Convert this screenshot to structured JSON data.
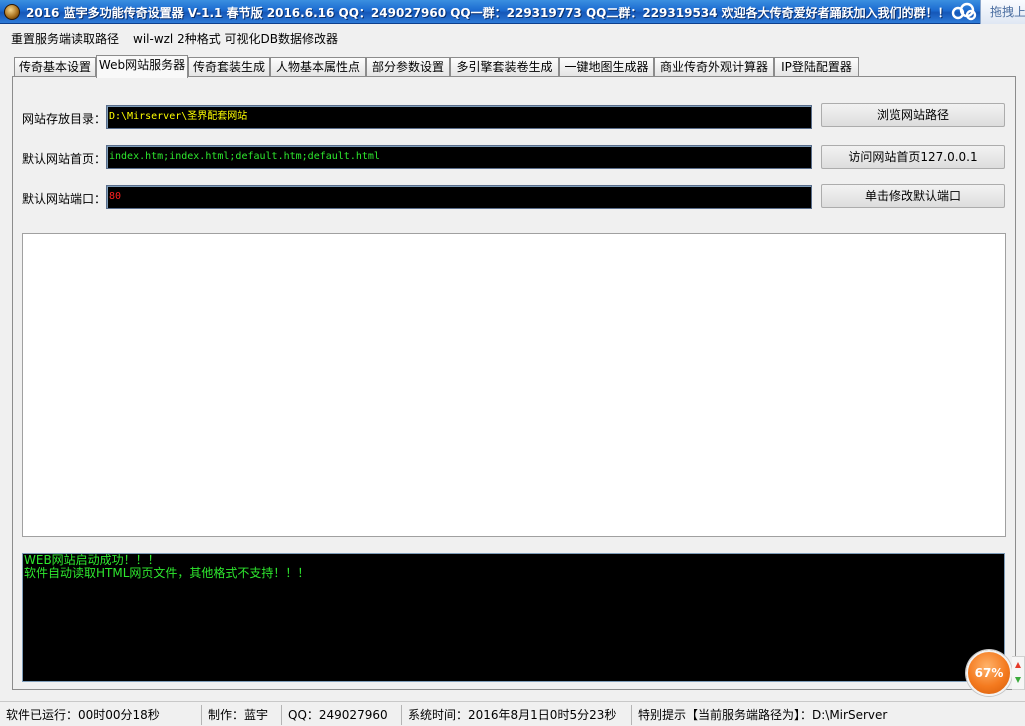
{
  "window": {
    "title": "2016 蓝宇多功能传奇设置器 V-1.1 春节版 2016.6.16  QQ：249027960 QQ一群：229319773 QQ二群：229319534  欢迎各大传奇爱好者踊跃加入我们的群！！",
    "drag_button": "拖拽上"
  },
  "menu": {
    "reset_path": "重置服务端读取路径",
    "db_editor": "wil-wzl 2种格式 可视化DB数据修改器"
  },
  "tabs": [
    {
      "label": "传奇基本设置"
    },
    {
      "label": "Web网站服务器"
    },
    {
      "label": "传奇套装生成"
    },
    {
      "label": "人物基本属性点"
    },
    {
      "label": "部分参数设置"
    },
    {
      "label": "多引擎套装卷生成"
    },
    {
      "label": "一键地图生成器"
    },
    {
      "label": "商业传奇外观计算器"
    },
    {
      "label": "IP登陆配置器"
    }
  ],
  "active_tab": "Web网站服务器",
  "web": {
    "dir_label": "网站存放目录：",
    "dir_value": "D:\\Mirserver\\圣界配套网站",
    "home_label": "默认网站首页：",
    "home_value": "index.htm;index.html;default.htm;default.html",
    "port_label": "默认网站端口：",
    "port_value": "80",
    "browse_button": "浏览网站路径",
    "visit_button": "访问网站首页127.0.0.1",
    "port_button": "单击修改默认端口"
  },
  "log": [
    "WEB网站启动成功！！！",
    "软件自动读取HTML网页文件，其他格式不支持！！！"
  ],
  "status": {
    "runtime": "软件已运行：00时00分18秒",
    "author": "制作：蓝宇",
    "qq": "QQ：249027960",
    "systime": "系统时间：2016年8月1日0时5分23秒",
    "notice": "特别提示【当前服务端路径为】：D:\\MirServer"
  },
  "speed_widget": {
    "percent": "67%"
  },
  "colors": {
    "titlebar": "#1C6BD0",
    "field_bg": "#000000",
    "dir_text": "#FFFF00",
    "home_text": "#2EE82E",
    "port_text": "#FF2020",
    "log_text": "#2EE82E",
    "speed_ball": "#F47A1F"
  }
}
